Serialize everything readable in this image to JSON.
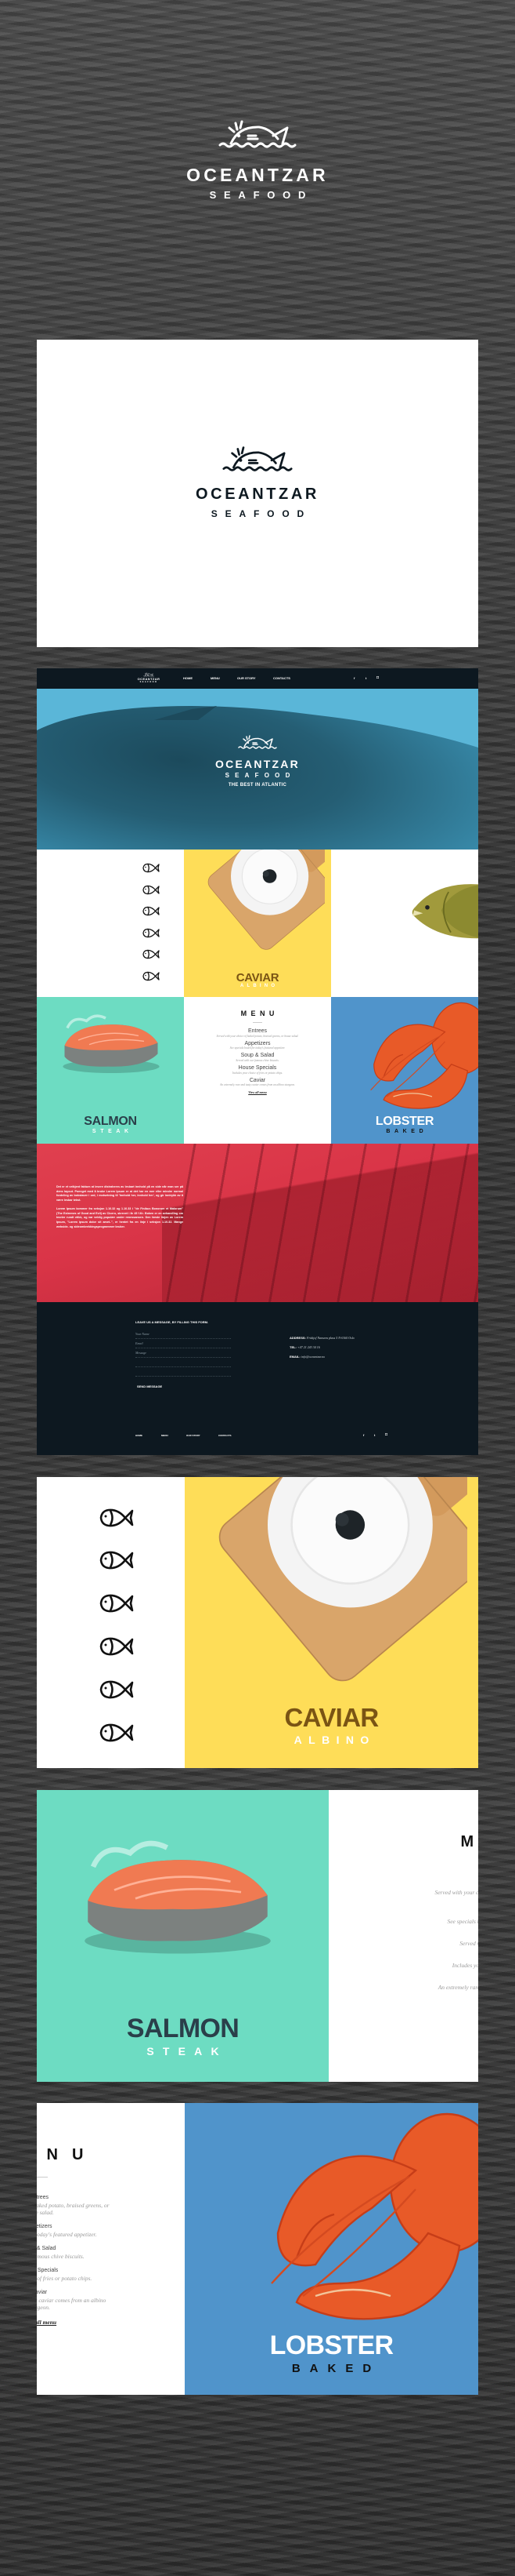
{
  "brand": {
    "name": "OCEANTZAR",
    "sub": "SEAFOOD",
    "tagline": "THE BEST IN ATLANTIC"
  },
  "colors": {
    "ocean_bg": "#3a3a3a",
    "navy": "#0d1820",
    "hero_blue": "#5ab6d8",
    "yellow": "#fedd58",
    "teal": "#6ddcc2",
    "blue": "#5094cb",
    "red": "#d93447",
    "caviar_brown": "#7a5414"
  },
  "nav": {
    "items": [
      {
        "label": "HOME"
      },
      {
        "label": "MENU"
      },
      {
        "label": "OUR STORY"
      },
      {
        "label": "CONTACTS"
      }
    ],
    "social": [
      "facebook-icon",
      "twitter-icon",
      "instagram-icon"
    ],
    "social_glyphs": {
      "facebook": "f",
      "twitter": "t",
      "instagram": "◘"
    }
  },
  "dishes": {
    "caviar": {
      "title": "CAVIAR",
      "sub": "ALBINO"
    },
    "salmon": {
      "title": "SALMON",
      "sub": "STEAK"
    },
    "lobster": {
      "title": "LOBSTER",
      "sub": "BAKED"
    }
  },
  "menu": {
    "title": "MENU",
    "items": [
      {
        "name": "Entrees",
        "desc": "Served with your choice of baked potato, braised greens, or house salad."
      },
      {
        "name": "Appetizers",
        "desc": "See specials board for today's featured appetizer."
      },
      {
        "name": "Soup & Salad",
        "desc": "Served with our famous chive biscuits."
      },
      {
        "name": "House Specials",
        "desc": "Includes your choice of fries or potato chips."
      },
      {
        "name": "Caviar",
        "desc": "An extremely rare and tasty caviar comes from an albino sturgeon."
      }
    ],
    "view_all": "View all menu"
  },
  "story": {
    "p1": "Det er et velkjent faktum at lesere distraheres av lesbart innhold på en side når man ser på dens layout. Poenget med å bruke Lorem Ipsum er at det har en mer eller mindre normal fordeling av bokstaver i ord, i motsetning til 'Innhold her, innhold her', og gir inntrykk av å være lesbar tekst.",
    "p2": "Lorem Ipsum kommer fra seksjon 1.10.32 og 1.10.33 i \"de Finibus Bonorum et Malorum\" (The Extremes of Good and Evil) av Cicero, skrevet i år 45 f.Kr. Boken er en avhandling om teorier rundt etikk, og var veldig populær under renessansen. Den første linjen av Lorem Ipsum, \"Lorem ipsum dolor sit amet..\", er hentet fra en linje i seksjon 1.10.32. Mange webside- og sideombrekkingsprogrammer bruker."
  },
  "contact": {
    "form_title": "LEAVE US A MESSAGE, BY FILLING THIS FORM.",
    "name_placeholder": "Your Name",
    "email_placeholder": "Email",
    "message_placeholder": "Message",
    "send": "SEND MESSAGE",
    "address_label": "ADDRESS:",
    "address": "Fridtjof Nansens plass 5 N-0160 Oslo",
    "tel_label": "TEL:",
    "tel": "+47 21 243 34 16",
    "email_label": "EMAIL:",
    "email": "info@oceantzar.no"
  }
}
